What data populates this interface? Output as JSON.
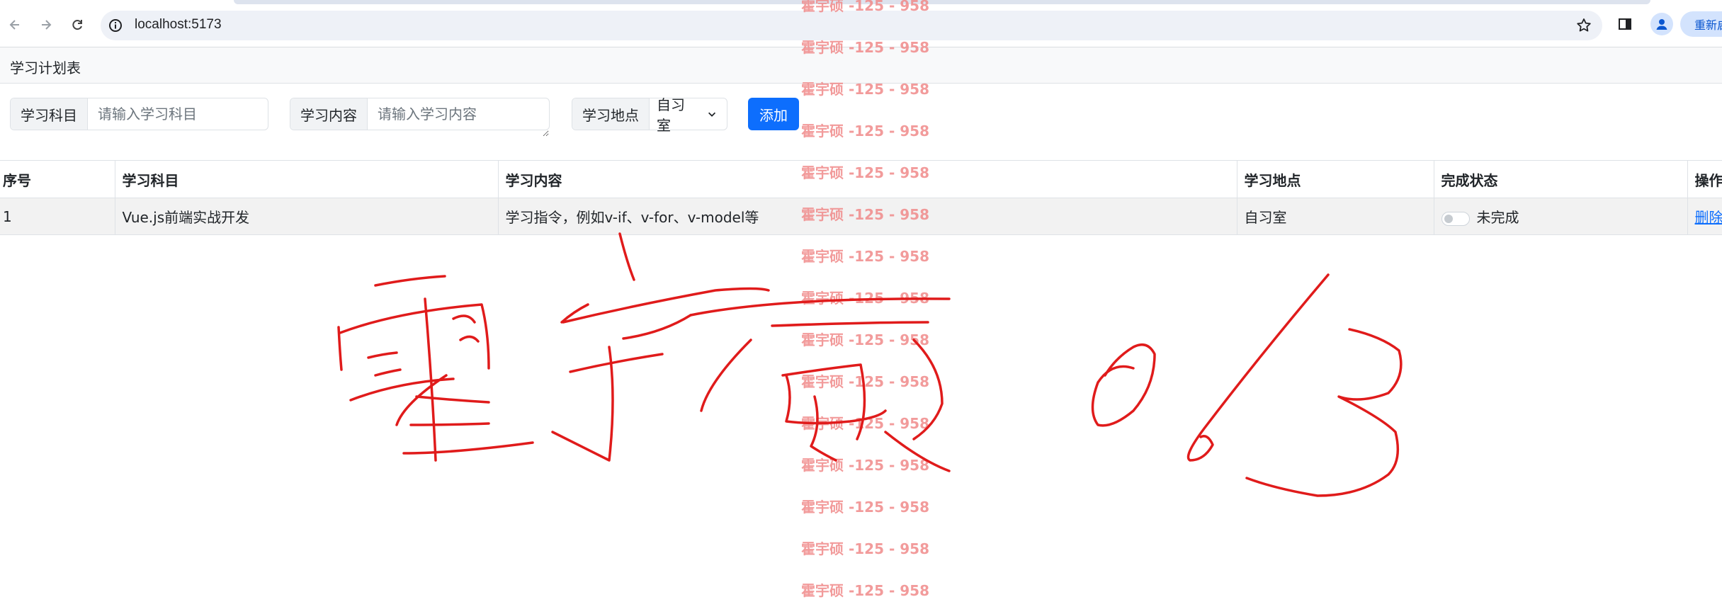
{
  "browser": {
    "url": "localhost:5173",
    "relaunch_label": "重新启"
  },
  "app": {
    "title": "学习计划表"
  },
  "form": {
    "subject_label": "学习科目",
    "subject_placeholder": "请输入学习科目",
    "content_label": "学习内容",
    "content_placeholder": "请输入学习内容",
    "location_label": "学习地点",
    "location_selected": "自习室",
    "add_label": "添加"
  },
  "table": {
    "headers": [
      "序号",
      "学习科目",
      "学习内容",
      "学习地点",
      "完成状态",
      "操作"
    ],
    "rows": [
      {
        "index": "1",
        "subject": "Vue.js前端实战开发",
        "content": "学习指令，例如v-if、v-for、v-model等",
        "location": "自习室",
        "status": "未完成",
        "action": "删除"
      }
    ]
  },
  "watermark": {
    "text": "霍宇硕 -125 - 958"
  },
  "colors": {
    "primary": "#0d6efd",
    "watermark": "#f08a8a",
    "ink": "#e01b1b"
  }
}
